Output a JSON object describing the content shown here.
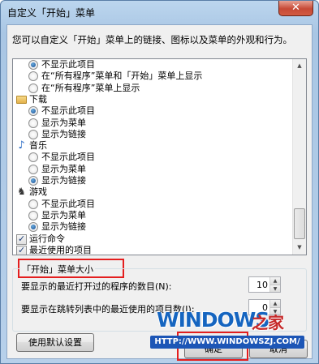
{
  "window": {
    "title": "自定义「开始」菜单",
    "close_glyph": "✕"
  },
  "description": "您可以自定义「开始」菜单上的链接、图标以及菜单的外观和行为。",
  "list": {
    "rows": [
      {
        "type": "radio",
        "label": "不显示此项目",
        "checked": true
      },
      {
        "type": "radio",
        "label": "在“所有程序”菜单和「开始」菜单上显示",
        "checked": false
      },
      {
        "type": "radio",
        "label": "在“所有程序”菜单上显示",
        "checked": false
      },
      {
        "type": "group",
        "label": "下载",
        "icon": "folder-icon"
      },
      {
        "type": "radio",
        "label": "不显示此项目",
        "checked": true
      },
      {
        "type": "radio",
        "label": "显示为菜单",
        "checked": false
      },
      {
        "type": "radio",
        "label": "显示为链接",
        "checked": false
      },
      {
        "type": "group",
        "label": "音乐",
        "icon": "music-note-icon"
      },
      {
        "type": "radio",
        "label": "不显示此项目",
        "checked": false
      },
      {
        "type": "radio",
        "label": "显示为菜单",
        "checked": false
      },
      {
        "type": "radio",
        "label": "显示为链接",
        "checked": true
      },
      {
        "type": "group",
        "label": "游戏",
        "icon": "games-icon"
      },
      {
        "type": "radio",
        "label": "不显示此项目",
        "checked": false
      },
      {
        "type": "radio",
        "label": "显示为菜单",
        "checked": false
      },
      {
        "type": "radio",
        "label": "显示为链接",
        "checked": true
      },
      {
        "type": "checkbox",
        "label": "运行命令",
        "checked": true
      },
      {
        "type": "checkbox",
        "label": "最近使用的项目",
        "checked": true
      }
    ]
  },
  "size_group": {
    "title": "「开始」菜单大小",
    "recent_programs_label": "要显示的最近打开过的程序的数目(N):",
    "recent_programs_value": "10",
    "jumplist_label": "要显示在跳转列表中的最近使用的项目数(I):",
    "jumplist_value": "0"
  },
  "buttons": {
    "use_defaults": "使用默认设置",
    "ok": "确定",
    "cancel": "取消"
  },
  "watermark": {
    "logo": "WINDOWS",
    "zh": "之家",
    "url": "HTTP://WWW.WINDOWSZJ.COM/"
  },
  "colors": {
    "highlight": "#e41e1e",
    "radio_dot": "#1a4d92"
  }
}
